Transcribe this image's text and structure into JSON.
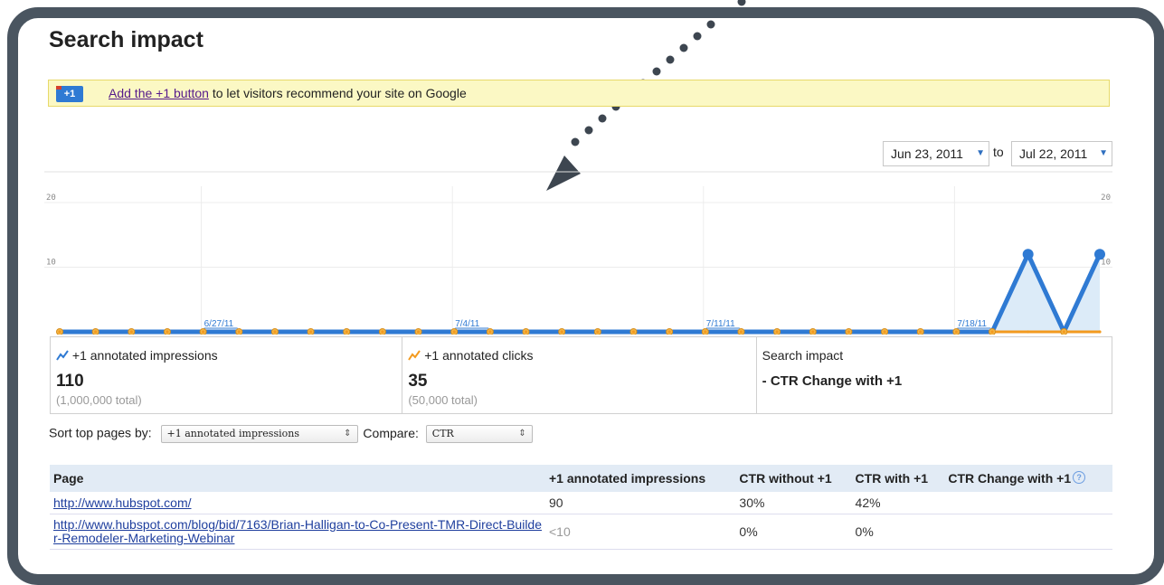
{
  "title": "Search impact",
  "promo": {
    "badge": "+1",
    "link_text": "Add the +1 button",
    "rest_text": " to let visitors recommend your site on Google"
  },
  "date_range": {
    "from": "Jun 23, 2011",
    "to_label": "to",
    "to": "Jul 22, 2011"
  },
  "chart_data": {
    "type": "line",
    "y_ticks": [
      "20",
      "10"
    ],
    "ylim": [
      0,
      20
    ],
    "x_tick_labels": [
      "6/27/11",
      "7/4/11",
      "7/11/11",
      "7/18/11"
    ],
    "x_tick_index": [
      4,
      11,
      18,
      25
    ],
    "series": [
      {
        "name": "+1 annotated impressions",
        "color": "#2f7ad3",
        "values": [
          0,
          0,
          0,
          0,
          0,
          0,
          0,
          0,
          0,
          0,
          0,
          0,
          0,
          0,
          0,
          0,
          0,
          0,
          0,
          0,
          0,
          0,
          0,
          0,
          0,
          0,
          0,
          12,
          0,
          12
        ]
      },
      {
        "name": "+1 annotated clicks",
        "color": "#f39a1e",
        "values": [
          0,
          0,
          0,
          0,
          0,
          0,
          0,
          0,
          0,
          0,
          0,
          0,
          0,
          0,
          0,
          0,
          0,
          0,
          0,
          0,
          0,
          0,
          0,
          0,
          0,
          0,
          0,
          0,
          0,
          0
        ]
      }
    ]
  },
  "stats": {
    "impressions": {
      "label": "+1 annotated impressions",
      "value": "110",
      "total": "(1,000,000 total)"
    },
    "clicks": {
      "label": "+1 annotated clicks",
      "value": "35",
      "total": "(50,000 total)"
    },
    "impact": {
      "label": "Search impact",
      "value": "- CTR Change with +1"
    }
  },
  "sort": {
    "label": "Sort top pages by:",
    "selected": "+1 annotated impressions",
    "compare_label": "Compare:",
    "compare_selected": "CTR"
  },
  "table": {
    "headers": [
      "Page",
      "+1 annotated impressions",
      "CTR without +1",
      "CTR with +1",
      "CTR Change with +1"
    ],
    "rows": [
      {
        "page": "http://www.hubspot.com/",
        "impressions": "90",
        "ctr_without": "30%",
        "ctr_with": "42%",
        "change": ""
      },
      {
        "page": "http://www.hubspot.com/blog/bid/7163/Brian-Halligan-to-Co-Present-TMR-Direct-Builder-Remodeler-Marketing-Webinar",
        "impressions": "<10",
        "ctr_without": "0%",
        "ctr_with": "0%",
        "change": ""
      }
    ]
  }
}
